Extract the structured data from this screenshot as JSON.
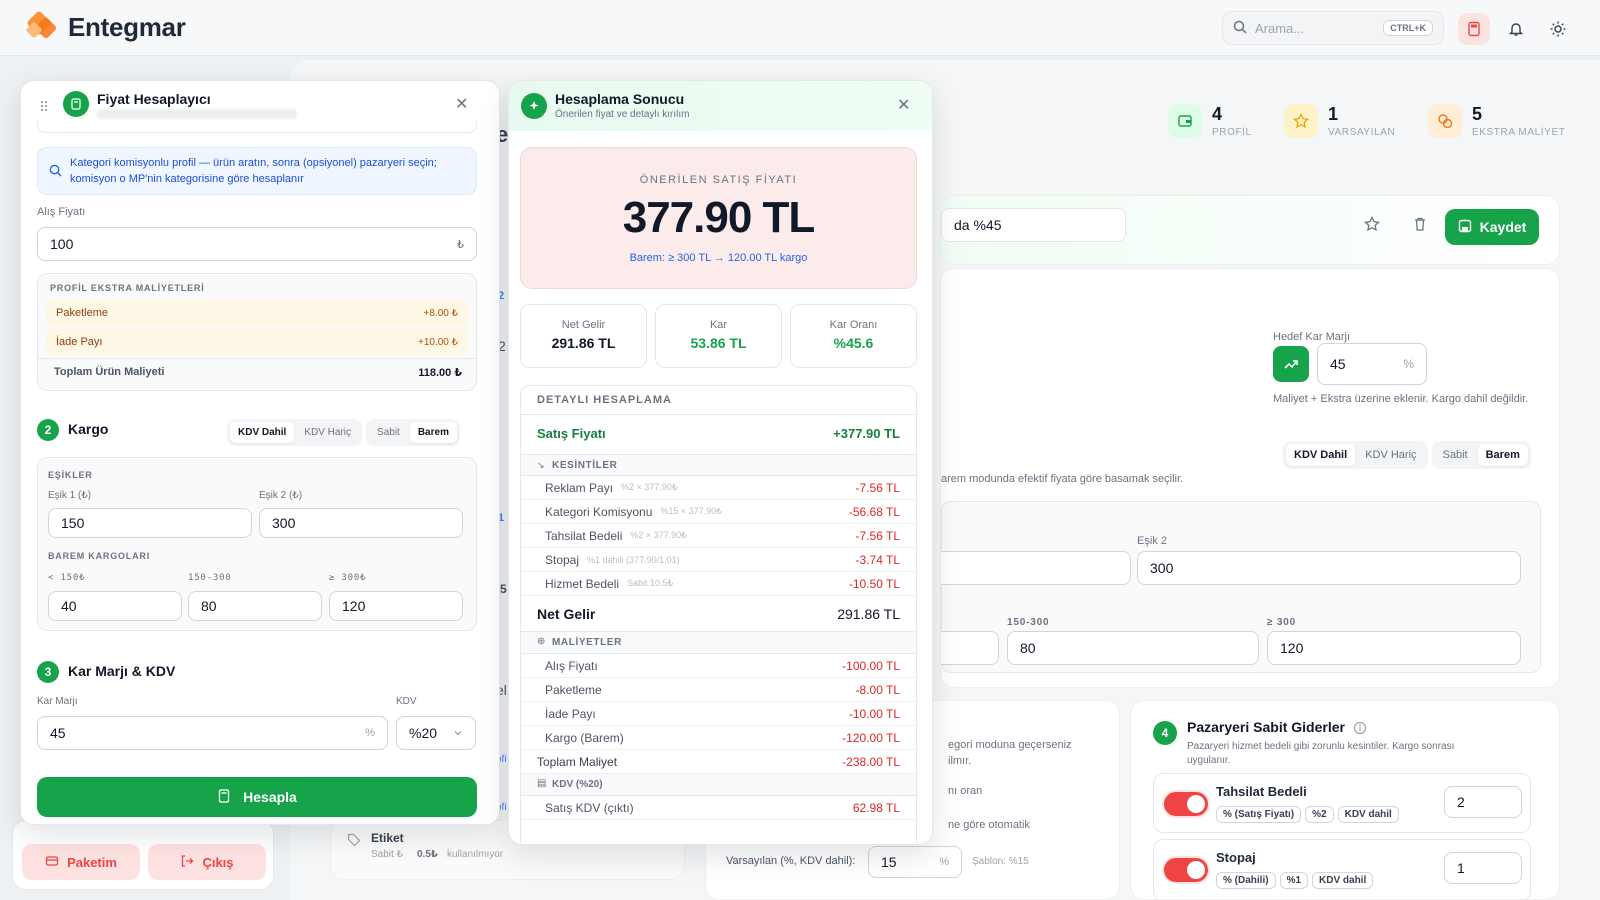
{
  "app": {
    "brand_a": "Entegmar",
    "search_placeholder": "Arama...",
    "search_kbd": "CTRL+K"
  },
  "stats": [
    {
      "num": "4",
      "label": "PROFİL",
      "color": "#16a34a",
      "icon": "wallet-icon"
    },
    {
      "num": "1",
      "label": "VARSAYILAN",
      "color": "#f59e0b",
      "icon": "star-icon"
    },
    {
      "num": "5",
      "label": "EKSTRA MALİYET",
      "color": "#f97316",
      "icon": "coins-icon"
    }
  ],
  "bg": {
    "profile_name": "da %45",
    "save_label": "Kaydet",
    "target_margin_label": "Hedef Kar Marjı",
    "target_margin_value": "45",
    "target_margin_unit": "%",
    "target_margin_note": "Maliyet + Ekstra üzerine eklenir. Kargo dahil değildir.",
    "kdv_dahil": "KDV Dahil",
    "kdv_haric": "KDV Hariç",
    "sabit": "Sabit",
    "barem": "Barem",
    "barem_note": "arem modunda efektif fiyata göre basamak seçilir.",
    "esik2_label": "Eşik 2",
    "esik2_value": "300",
    "tier_mid_label": "150-300",
    "tier_hi_label": "≥ 300",
    "tier_mid_value": "80",
    "tier_hi_value": "120",
    "left_note_1": "egori moduna geçerseniz",
    "left_note_2": "ilmır.",
    "left_note_3": "nı oran",
    "left_note_4": "ne göre otomatik",
    "default_label": "Varsayılan (%, KDV dahil):",
    "default_value": "15",
    "default_unit": "%",
    "default_template": "Şablon: %15",
    "section4_num": "4",
    "section4_title": "Pazaryeri Sabit Giderler",
    "section4_desc_1": "Pazaryeri hizmet bedeli gibi zorunlu kesintiler. Kargo sonrası",
    "section4_desc_2": "uygulanır.",
    "fee1_title": "Tahsilat Bedeli",
    "fee1_chips": [
      "% (Satış Fiyatı)",
      "%2",
      "KDV dahil"
    ],
    "fee1_value": "2",
    "fee2_title": "Stopaj",
    "fee2_chips": [
      "% (Dahili)",
      "%1",
      "KDV dahil"
    ],
    "fee2_value": "1",
    "etiket_label": "Etiket",
    "etiket_sub_1": "Sabit ₺",
    "etiket_sub_2": "0.5₺",
    "etiket_sub_3": "kullanılmıyor",
    "peek_2a": "2",
    "peek_2b": "2",
    "peek_1": "1",
    "peek_5": "5",
    "peek_el": "el",
    "peek_ofi_1": "ofi",
    "peek_ofi_2": "ofi",
    "paket_btn": "Paketim",
    "cikis_btn": "Çıkış"
  },
  "calc": {
    "title": "Fiyat Hesaplayıcı",
    "info": "Kategori komisyonlu profil — ürün aratın, sonra (opsiyonel) pazaryeri seçin; komisyon o MP'nin kategorisine göre hesaplanır",
    "alis_label": "Alış Fiyatı",
    "alis_value": "100",
    "alis_unit": "₺",
    "extras_title": "PROFİL EKSTRA MALİYETLERİ",
    "extras": [
      {
        "name": "Paketleme",
        "value": "+8.00 ₺"
      },
      {
        "name": "İade Payı",
        "value": "+10.00 ₺"
      }
    ],
    "total_label": "Toplam Ürün Maliyeti",
    "total_value": "118.00 ₺",
    "sec2_num": "2",
    "sec2_title": "Kargo",
    "kdv_dahil": "KDV Dahil",
    "kdv_haric": "KDV Hariç",
    "sabit": "Sabit",
    "barem": "Barem",
    "esikler": "EŞİKLER",
    "esik1_label": "Eşik 1 (₺)",
    "esik2_label": "Eşik 2 (₺)",
    "esik1_value": "150",
    "esik2_value": "300",
    "barem_title": "BAREM KARGOLARI",
    "tier_labels": [
      "< 150₺",
      "150-300",
      "≥ 300₺"
    ],
    "tier_values": [
      "40",
      "80",
      "120"
    ],
    "sec3_num": "3",
    "sec3_title": "Kar Marjı & KDV",
    "margin_label": "Kar Marjı",
    "margin_value": "45",
    "margin_unit": "%",
    "kdv_label": "KDV",
    "kdv_value": "%20",
    "hesapla": "Hesapla"
  },
  "result": {
    "title": "Hesaplama Sonucu",
    "subtitle": "Önerilen fiyat ve detaylı kırılım",
    "hero_label": "ÖNERİLEN SATIŞ FİYATI",
    "hero_value": "377.90 TL",
    "hero_note": "Barem: ≥ 300 TL → 120.00 TL kargo",
    "metrics": [
      {
        "label": "Net Gelir",
        "value": "291.86 TL",
        "color": "#111827"
      },
      {
        "label": "Kar",
        "value": "53.86 TL",
        "color": "#16a34a"
      },
      {
        "label": "Kar Oranı",
        "value": "%45.6",
        "color": "#16a34a"
      }
    ],
    "detail_title": "DETAYLI HESAPLAMA",
    "sales_label": "Satış Fiyatı",
    "sales_value": "+377.90 TL",
    "kesintiler_title": "KESİNTİLER",
    "kesintiler": [
      {
        "name": "Reklam Payı",
        "formula": "%2 × 377.90₺",
        "value": "-7.56 TL"
      },
      {
        "name": "Kategori Komisyonu",
        "formula": "%15 × 377.90₺",
        "value": "-56.68 TL"
      },
      {
        "name": "Tahsilat Bedeli",
        "formula": "%2 × 377.90₺",
        "value": "-7.56 TL"
      },
      {
        "name": "Stopaj",
        "formula": "%1 dahili (377.90/1.01)",
        "value": "-3.74 TL"
      },
      {
        "name": "Hizmet Bedeli",
        "formula": "Sabit 10.5₺",
        "value": "-10.50 TL"
      }
    ],
    "net_label": "Net Gelir",
    "net_value": "291.86 TL",
    "maliyetler_title": "MALİYETLER",
    "maliyetler": [
      {
        "name": "Alış Fiyatı",
        "value": "-100.00 TL"
      },
      {
        "name": "Paketleme",
        "value": "-8.00 TL"
      },
      {
        "name": "İade Payı",
        "value": "-10.00 TL"
      },
      {
        "name": "Kargo (Barem)",
        "value": "-120.00 TL"
      }
    ],
    "total_cost_label": "Toplam Maliyet",
    "total_cost_value": "-238.00 TL",
    "kdv_title": "KDV (%20)",
    "kdv_row_label": "Satış KDV (çıktı)",
    "kdv_row_value": "62.98 TL"
  }
}
